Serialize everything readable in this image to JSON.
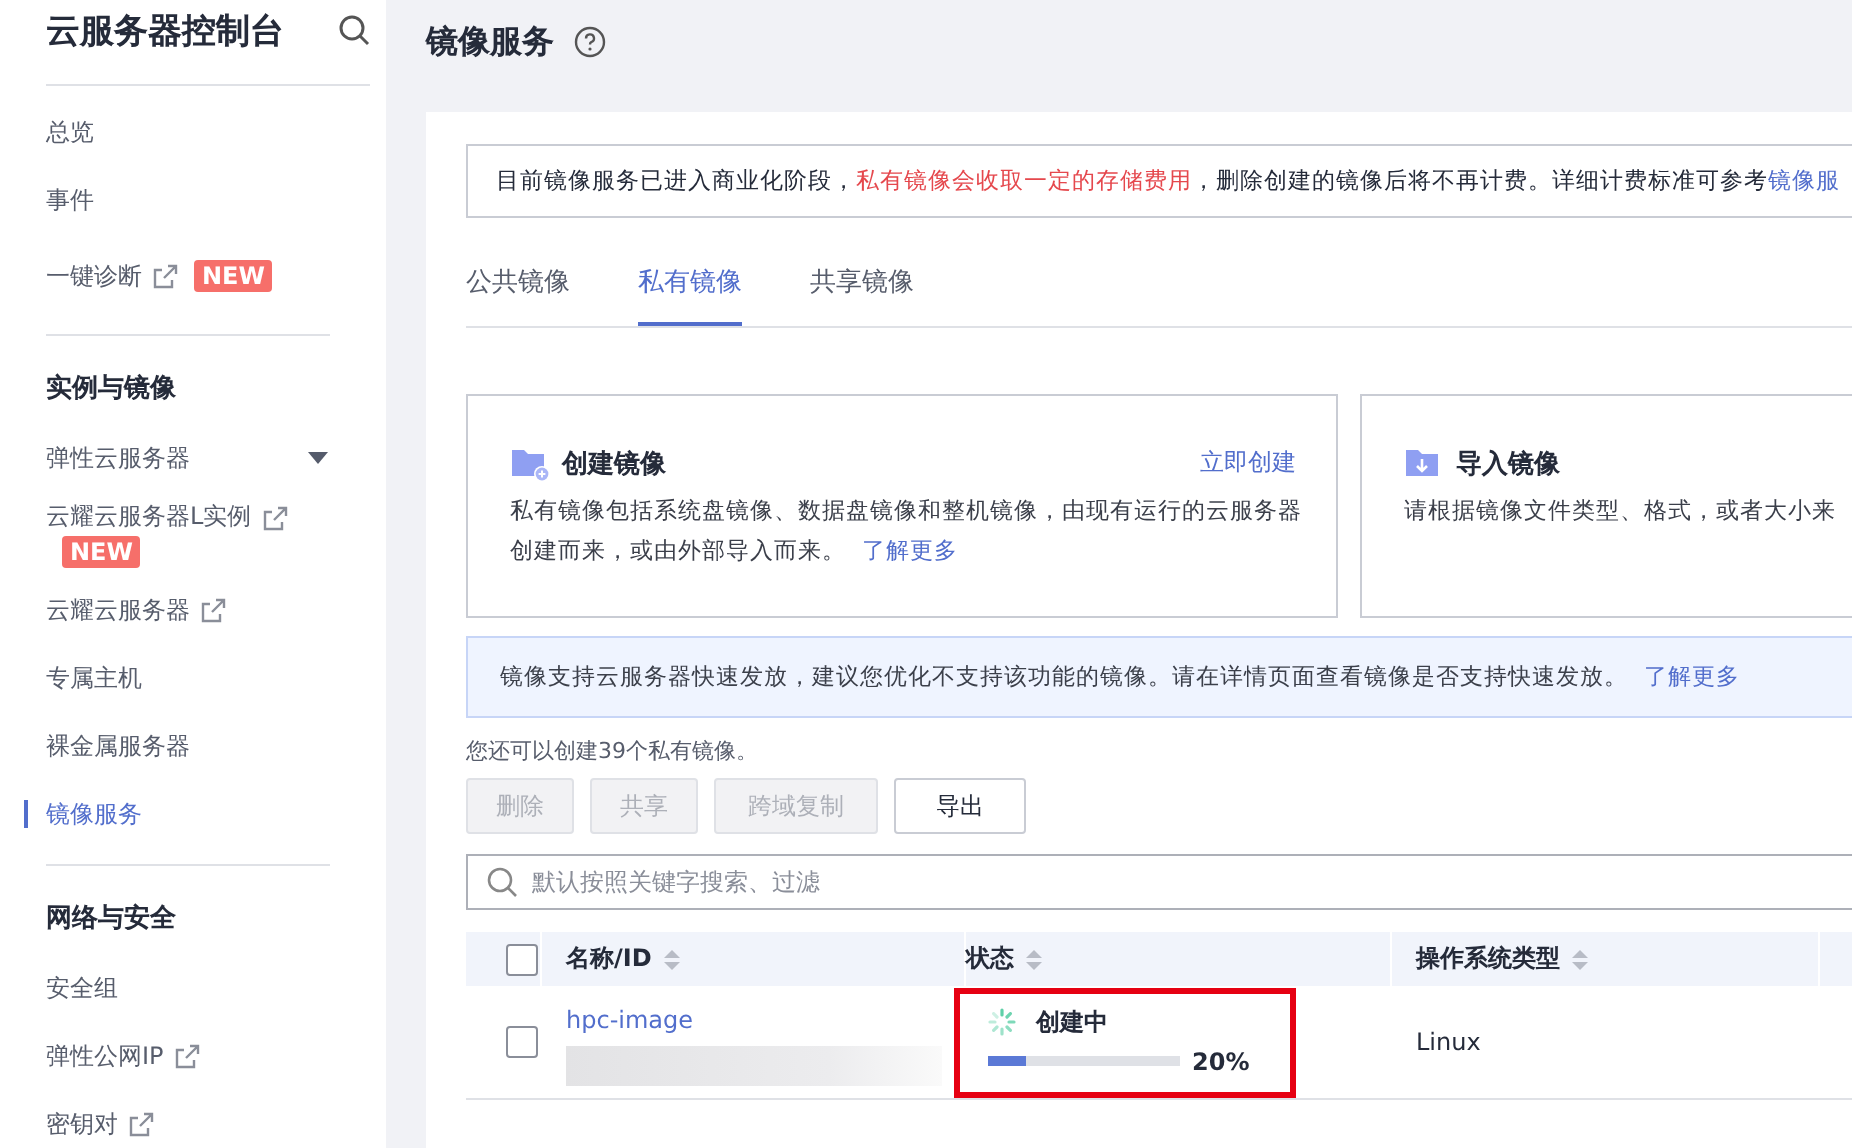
{
  "sidebar": {
    "title": "云服务器控制台",
    "groups": [
      {
        "items": [
          {
            "label": "总览",
            "external": false,
            "selected": false
          },
          {
            "label": "事件",
            "external": false,
            "selected": false
          },
          {
            "label": "一键诊断",
            "external": true,
            "badge": "NEW",
            "selected": false
          }
        ]
      },
      {
        "heading": "实例与镜像",
        "items": [
          {
            "label": "弹性云服务器",
            "external": false,
            "expandable": true,
            "selected": false
          },
          {
            "label": "云耀云服务器L实例",
            "external": true,
            "badge": "NEW",
            "selected": false
          },
          {
            "label": "云耀云服务器",
            "external": true,
            "selected": false
          },
          {
            "label": "专属主机",
            "external": false,
            "selected": false
          },
          {
            "label": "裸金属服务器",
            "external": false,
            "selected": false
          },
          {
            "label": "镜像服务",
            "external": false,
            "selected": true
          }
        ]
      },
      {
        "heading": "网络与安全",
        "items": [
          {
            "label": "安全组",
            "external": false,
            "selected": false
          },
          {
            "label": "弹性公网IP",
            "external": true,
            "selected": false
          },
          {
            "label": "密钥对",
            "external": true,
            "selected": false
          }
        ]
      }
    ]
  },
  "page_title": "镜像服务",
  "notice": {
    "parts": [
      {
        "kind": "plain",
        "text": "目前镜像服务已进入商业化阶段，"
      },
      {
        "kind": "warning",
        "text": "私有镜像会收取一定的存储费用"
      },
      {
        "kind": "plain",
        "text": "，删除创建的镜像后将不再计费。详细计费标准可参考"
      },
      {
        "kind": "link",
        "text": "镜像服"
      }
    ]
  },
  "tabs": [
    {
      "label": "公共镜像",
      "selected": false
    },
    {
      "label": "私有镜像",
      "selected": true
    },
    {
      "label": "共享镜像",
      "selected": false
    }
  ],
  "cards": [
    {
      "kind": "create",
      "title": "创建镜像",
      "action": "立即创建",
      "description": "私有镜像包括系统盘镜像、数据盘镜像和整机镜像，由现有运行的云服务器创建而来，或由外部导入而来。",
      "link": "了解更多"
    },
    {
      "kind": "import",
      "title": "导入镜像",
      "description": "请根据镜像文件类型、格式，或者大小来"
    }
  ],
  "info": {
    "text": "镜像支持云服务器快速发放，建议您优化不支持该功能的镜像。请在详情页面查看镜像是否支持快速发放。",
    "link": "了解更多"
  },
  "quota_text": "您还可以创建39个私有镜像。",
  "actions": [
    {
      "label": "删除",
      "disabled": true
    },
    {
      "label": "共享",
      "disabled": true
    },
    {
      "label": "跨域复制",
      "disabled": true
    },
    {
      "label": "导出",
      "disabled": false
    }
  ],
  "search": {
    "placeholder": "默认按照关键字搜索、过滤"
  },
  "table": {
    "all_checked": false,
    "columns": [
      "名称/ID",
      "状态",
      "操作系统类型"
    ],
    "rows": [
      {
        "checked": false,
        "name": "hpc-image",
        "status": "创建中",
        "level": 0.2,
        "reading": "20%",
        "highlighted": true,
        "os": "Linux"
      }
    ]
  }
}
